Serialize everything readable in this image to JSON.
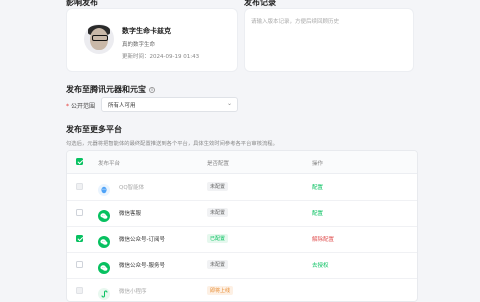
{
  "top_section": {
    "bot_header": "影响发布",
    "log_header": "发布记录"
  },
  "bot": {
    "name": "数字生命卡兹克",
    "description": "真的数字生命",
    "publish_time": "更新时间：2024-09-19 01:43"
  },
  "log": {
    "placeholder": "请输入版本记录，方便后续回顾历史"
  },
  "tencent": {
    "header": "发布至腾讯元器和元宝",
    "scope_label": "公开范围",
    "scope_value": "所有人可用"
  },
  "more": {
    "header": "发布至更多平台",
    "hint": "勾选后，元器将把智能体的最终配置推送到各个平台，具体生效时间参考各平台审核流程。"
  },
  "table": {
    "col_platform": "发布平台",
    "col_config": "是否配置",
    "col_action": "操作",
    "rows": [
      {
        "name": "QQ智能体",
        "status": "未配置",
        "status_type": "none",
        "action": "配置",
        "action_type": "green",
        "icon": "qq-icon",
        "icon_color": "#4fa3f7",
        "checked": false,
        "disabled": true
      },
      {
        "name": "微信客服",
        "status": "未配置",
        "status_type": "none",
        "action": "配置",
        "action_type": "green",
        "icon": "wechat-icon",
        "icon_color": "#07c160",
        "checked": false,
        "disabled": false
      },
      {
        "name": "微信公众号-订阅号",
        "status": "已配置",
        "status_type": "ok",
        "action": "解除配置",
        "action_type": "red",
        "icon": "wechat-icon",
        "icon_color": "#07c160",
        "checked": true,
        "disabled": false
      },
      {
        "name": "微信公众号-服务号",
        "status": "未配置",
        "status_type": "none",
        "action": "去授权",
        "action_type": "green",
        "icon": "wechat-icon",
        "icon_color": "#07c160",
        "checked": false,
        "disabled": false
      },
      {
        "name": "微信小程序",
        "status": "即将上线",
        "status_type": "soon",
        "action": "",
        "action_type": "none",
        "icon": "mini-program-icon",
        "icon_color": "#07c160",
        "checked": false,
        "disabled": true
      }
    ]
  }
}
